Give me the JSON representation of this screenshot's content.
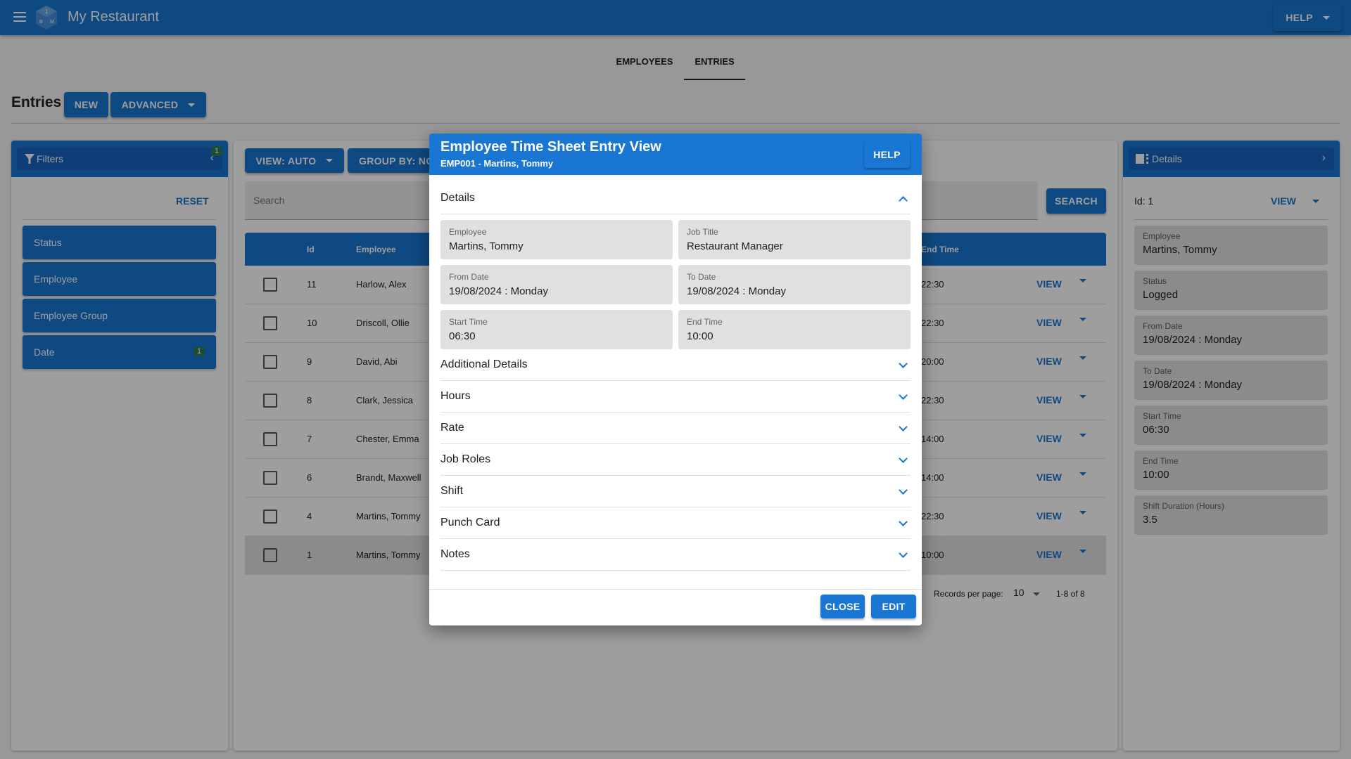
{
  "appbar": {
    "title": "My Restaurant",
    "help_label": "HELP",
    "colors": {
      "primary": "#1976d2"
    }
  },
  "tabs": [
    {
      "label": "EMPLOYEES",
      "active": false
    },
    {
      "label": "ENTRIES",
      "active": true
    }
  ],
  "page": {
    "title": "Entries",
    "new_label": "NEW",
    "advanced_label": "ADVANCED"
  },
  "filters": {
    "title": "Filters",
    "badge": "1",
    "reset_label": "RESET",
    "items": [
      {
        "label": "Status"
      },
      {
        "label": "Employee"
      },
      {
        "label": "Employee Group"
      },
      {
        "label": "Date",
        "badge": "1"
      }
    ]
  },
  "toolbar": {
    "view_label": "VIEW: AUTO",
    "group_label": "GROUP BY: NONE",
    "search_placeholder": "Search",
    "search_label": "SEARCH"
  },
  "table": {
    "columns": [
      "Id",
      "Employee",
      "End Time"
    ],
    "rows": [
      {
        "id": "11",
        "employee": "Harlow, Alex",
        "end_time": "22:30"
      },
      {
        "id": "10",
        "employee": "Driscoll, Ollie",
        "end_time": "22:30"
      },
      {
        "id": "9",
        "employee": "David, Abi",
        "end_time": "20:00"
      },
      {
        "id": "8",
        "employee": "Clark, Jessica",
        "end_time": "22:30"
      },
      {
        "id": "7",
        "employee": "Chester, Emma",
        "end_time": "14:00"
      },
      {
        "id": "6",
        "employee": "Brandt, Maxwell",
        "end_time": "14:00"
      },
      {
        "id": "4",
        "employee": "Martins, Tommy",
        "end_time": "22:30"
      },
      {
        "id": "1",
        "employee": "Martins, Tommy",
        "end_time": "10:00",
        "selected": true
      }
    ],
    "view_label": "VIEW",
    "records_per_page_label": "Records per page:",
    "records_per_page": "10",
    "range": "1-8 of 8"
  },
  "details_panel": {
    "title": "Details",
    "id_label": "Id: 1",
    "view_label": "VIEW",
    "fields": [
      {
        "label": "Employee",
        "value": "Martins, Tommy"
      },
      {
        "label": "Status",
        "value": "Logged"
      },
      {
        "label": "From Date",
        "value": "19/08/2024 : Monday"
      },
      {
        "label": "To Date",
        "value": "19/08/2024 : Monday"
      },
      {
        "label": "Start Time",
        "value": "06:30"
      },
      {
        "label": "End Time",
        "value": "10:00"
      },
      {
        "label": "Shift Duration (Hours)",
        "value": "3.5"
      }
    ]
  },
  "modal": {
    "title": "Employee Time Sheet Entry View",
    "subtitle": "EMP001 - Martins, Tommy",
    "help_label": "HELP",
    "details_section": "Details",
    "fields": [
      {
        "label": "Employee",
        "value": "Martins, Tommy"
      },
      {
        "label": "Job Title",
        "value": "Restaurant Manager"
      },
      {
        "label": "From Date",
        "value": "19/08/2024 : Monday"
      },
      {
        "label": "To Date",
        "value": "19/08/2024 : Monday"
      },
      {
        "label": "Start Time",
        "value": "06:30"
      },
      {
        "label": "End Time",
        "value": "10:00"
      }
    ],
    "sections": [
      "Additional Details",
      "Hours",
      "Rate",
      "Job Roles",
      "Shift",
      "Punch Card",
      "Notes"
    ],
    "close_label": "CLOSE",
    "edit_label": "EDIT"
  }
}
